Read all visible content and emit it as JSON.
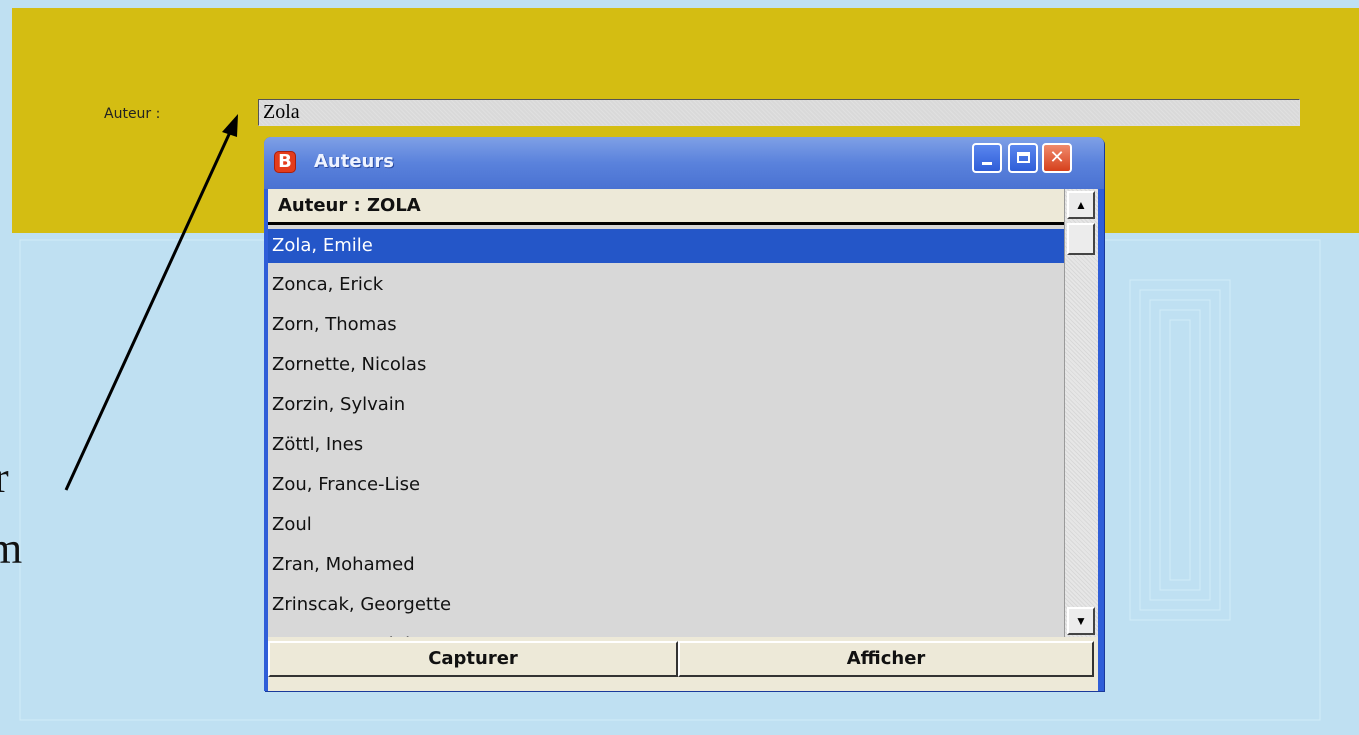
{
  "form": {
    "author_label": "Auteur :",
    "author_value": "Zola"
  },
  "slide_text": {
    "line1": "r",
    "line2": "m"
  },
  "window": {
    "icon_letter": "B",
    "title": "Auteurs",
    "controls": {
      "minimize_icon": "minimize-icon",
      "maximize_icon": "maximize-icon",
      "close_glyph": "✕"
    }
  },
  "list": {
    "header": "Auteur  : ZOLA",
    "selected_index": 0,
    "items": [
      "Zola, Emile",
      "Zonca, Erick",
      "Zorn, Thomas",
      "Zornette, Nicolas",
      "Zorzin, Sylvain",
      "Zöttl, Ines",
      "Zou, France-Lise",
      "Zoul",
      "Zran, Mohamed",
      "Zrinscak, Georgette",
      "Zuccante, Luigi"
    ],
    "scroll_up_glyph": "▲",
    "scroll_down_glyph": "▼"
  },
  "buttons": {
    "capturer": "Capturer",
    "afficher": "Afficher"
  },
  "colors": {
    "header_band": "#d4bd12",
    "background": "#bfe0f2",
    "titlebar": "#5a82dc",
    "selection": "#2456c8",
    "close_button": "#d6401c"
  }
}
